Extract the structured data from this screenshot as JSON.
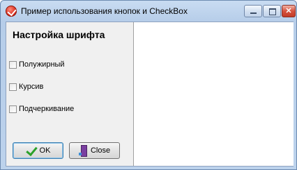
{
  "window": {
    "title": "Пример использования кнопок и CheckBox",
    "controls": {
      "minimize": "minimize",
      "maximize": "maximize",
      "close": "✕"
    }
  },
  "panel": {
    "heading": "Настройка шрифта",
    "checkboxes": [
      {
        "label": "Полужирный",
        "checked": false
      },
      {
        "label": "Курсив",
        "checked": false
      },
      {
        "label": "Подчеркивание",
        "checked": false
      }
    ],
    "buttons": {
      "ok": "OK",
      "close": "Close"
    }
  },
  "icons": {
    "app": "app-icon",
    "ok": "checkmark-icon",
    "close": "door-exit-icon"
  }
}
